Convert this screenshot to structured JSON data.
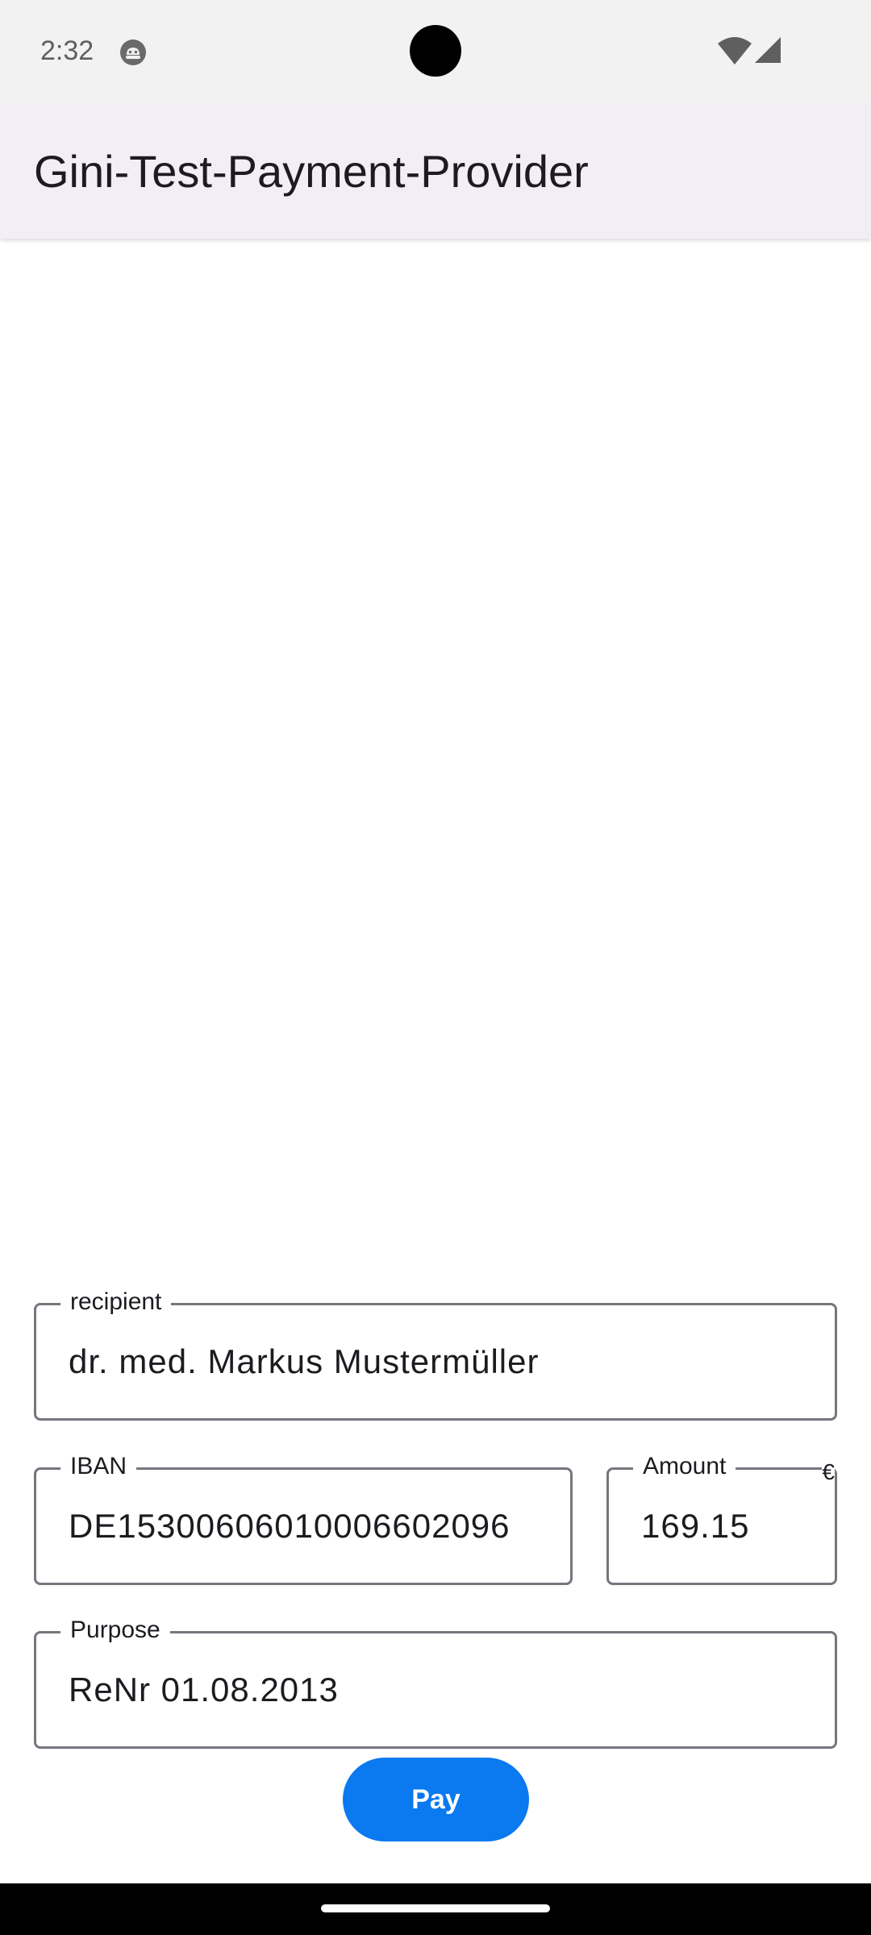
{
  "status_bar": {
    "time": "2:32",
    "icons": [
      "app-notification-icon",
      "wifi-icon",
      "cellular-signal-icon"
    ]
  },
  "app_bar": {
    "title": "Gini-Test-Payment-Provider"
  },
  "form": {
    "recipient": {
      "label": "recipient",
      "value": "dr. med. Markus Mustermüller"
    },
    "iban": {
      "label": "IBAN",
      "value": "DE15300606010006602096"
    },
    "amount": {
      "label": "Amount",
      "value": "169.15",
      "suffix": "€"
    },
    "purpose": {
      "label": "Purpose",
      "value": "ReNr 01.08.2013"
    },
    "pay_button_label": "Pay"
  },
  "colors": {
    "accent": "#0b79f0",
    "app_bar_background": "#f3eef6",
    "field_outline": "#79747e"
  }
}
